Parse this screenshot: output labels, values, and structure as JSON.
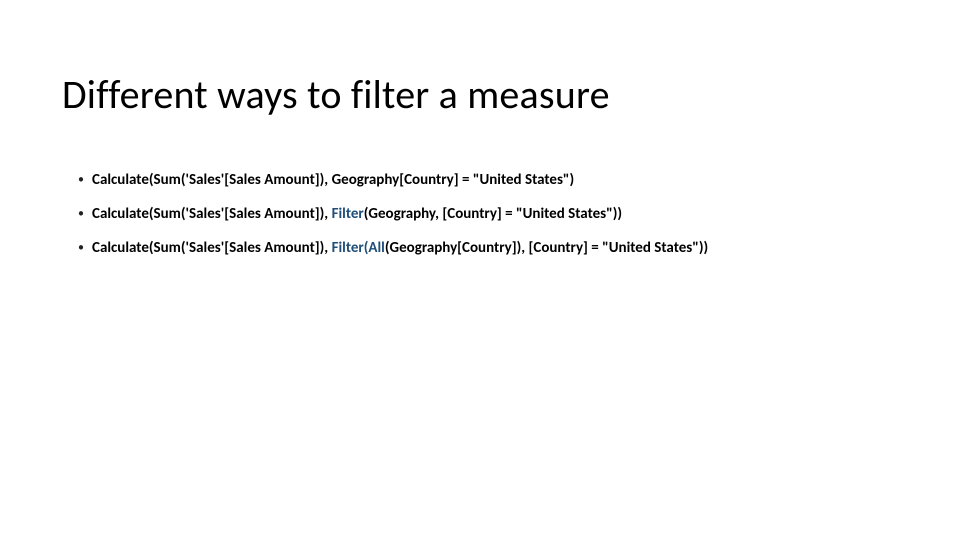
{
  "title": "Different ways to filter a measure",
  "bullets": [
    {
      "prefix": "Calculate(Sum('Sales'[Sales Amount]), ",
      "blue": "",
      "mid": "Geography[Country] = \"United States\"",
      "suffix": ")"
    },
    {
      "prefix": "Calculate(Sum('Sales'[Sales Amount]), ",
      "blue": "Filter",
      "mid": "(Geography, [Country] = \"United States\")",
      "suffix": ")"
    },
    {
      "prefix": "Calculate(Sum('Sales'[Sales Amount]), ",
      "blue": "Filter(All",
      "mid": "(Geography[Country]), [Country] = \"United States\")",
      "suffix": ")"
    }
  ]
}
